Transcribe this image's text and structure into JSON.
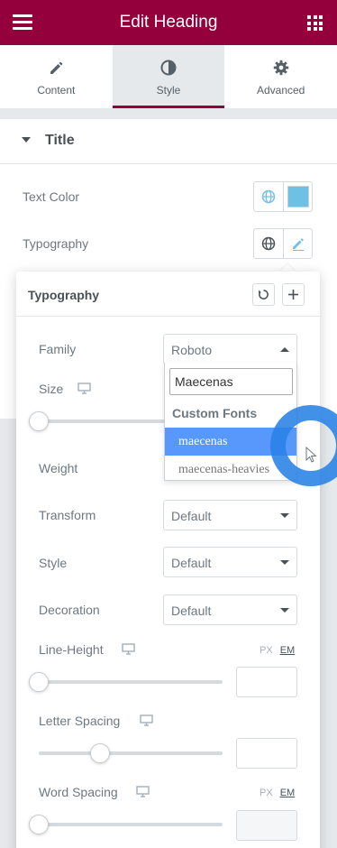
{
  "header": {
    "title": "Edit Heading",
    "menu_icon": "hamburger-icon",
    "apps_icon": "grid-icon"
  },
  "tabs": [
    {
      "label": "Content",
      "icon": "pencil-icon",
      "active": false
    },
    {
      "label": "Style",
      "icon": "contrast-icon",
      "active": true
    },
    {
      "label": "Advanced",
      "icon": "gear-icon",
      "active": false
    }
  ],
  "section": {
    "title": "Title"
  },
  "controls": {
    "text_color": {
      "label": "Text Color",
      "swatch": "#6ec1e4"
    },
    "typography": {
      "label": "Typography"
    }
  },
  "popover": {
    "title": "Typography",
    "family": {
      "label": "Family",
      "value": "Roboto"
    },
    "size": {
      "label": "Size"
    },
    "weight": {
      "label": "Weight"
    },
    "transform": {
      "label": "Transform",
      "value": "Default"
    },
    "style": {
      "label": "Style",
      "value": "Default"
    },
    "decoration": {
      "label": "Decoration",
      "value": "Default"
    },
    "line_height": {
      "label": "Line-Height",
      "unit_px": "PX",
      "unit_em": "EM"
    },
    "letter_spacing": {
      "label": "Letter Spacing"
    },
    "word_spacing": {
      "label": "Word Spacing",
      "unit_px": "PX",
      "unit_em": "EM"
    }
  },
  "dropdown": {
    "search_value": "Maecenas",
    "group_label": "Custom Fonts",
    "options": [
      "maecenas",
      "maecenas-heavies"
    ],
    "highlighted": "maecenas"
  },
  "colors": {
    "brand": "#93003c",
    "swatch": "#6ec1e4",
    "highlight": "#5897fb",
    "cursor_ring": "#2882e6"
  }
}
